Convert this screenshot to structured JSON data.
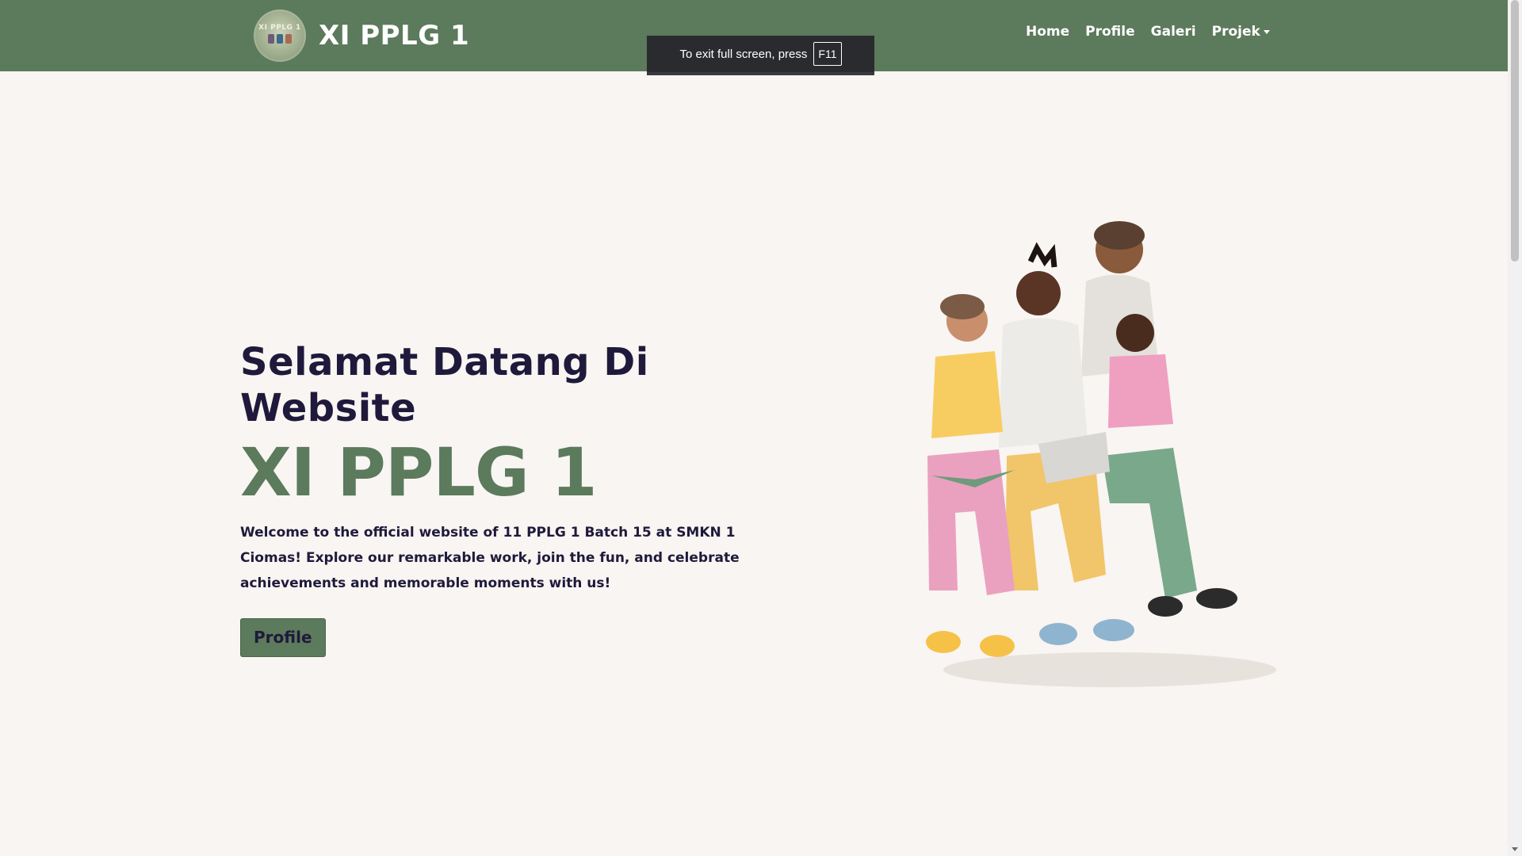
{
  "navbar": {
    "logo_label": "XI PPLG 1",
    "brand_title": "XI PPLG 1",
    "links": [
      {
        "label": "Home"
      },
      {
        "label": "Profile"
      },
      {
        "label": "Galeri"
      },
      {
        "label": "Projek"
      }
    ]
  },
  "fullscreen_toast": {
    "message": "To exit full screen, press",
    "key": "F11"
  },
  "hero": {
    "heading": "Selamat Datang Di Website",
    "class_name": "XI PPLG 1",
    "description": "Welcome to the official website of 11 PPLG 1 Batch 15 at SMKN 1 Ciomas! Explore our remarkable work, join the fun, and celebrate achievements and memorable moments with us!",
    "button_label": "Profile"
  },
  "colors": {
    "brand_green": "#5c7a5c",
    "heading_navy": "#1f1a3b",
    "page_background": "#f8f5f2"
  },
  "icons": {
    "logo": "class-logo-badge",
    "dropdown": "caret-down-icon",
    "illustration": "students-reading-illustration"
  }
}
